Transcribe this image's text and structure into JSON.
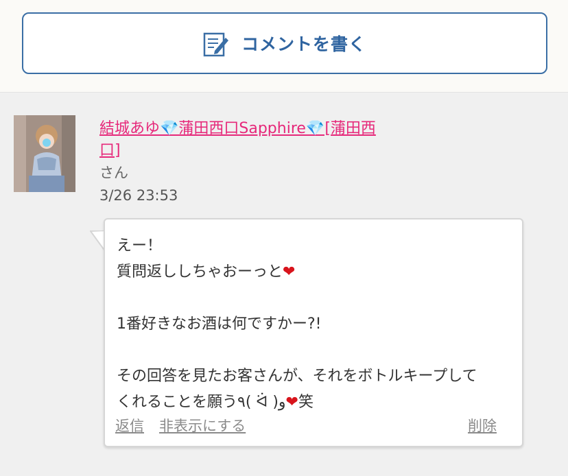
{
  "write_button": {
    "label": "コメントを書く",
    "icon": "edit-note-icon"
  },
  "comment": {
    "author": "結城あゆ💎蒲田西口Sapphire💎[蒲田西口]",
    "honorific": "さん",
    "datetime": "3/26 23:53",
    "lines": [
      "えー！",
      "質問返ししちゃおーっと",
      "",
      "1番好きなお酒は何ですかー?!",
      "",
      "その回答を見たお客さんが、それをボトルキープして",
      "くれることを願う٩( ᐛ )و",
      "笑"
    ],
    "actions": {
      "reply": "返信",
      "hide": "非表示にする",
      "delete": "削除"
    }
  },
  "colors": {
    "accent_blue": "#2f64a0",
    "author_pink": "#e6287a",
    "heart_red": "#d8141c"
  }
}
